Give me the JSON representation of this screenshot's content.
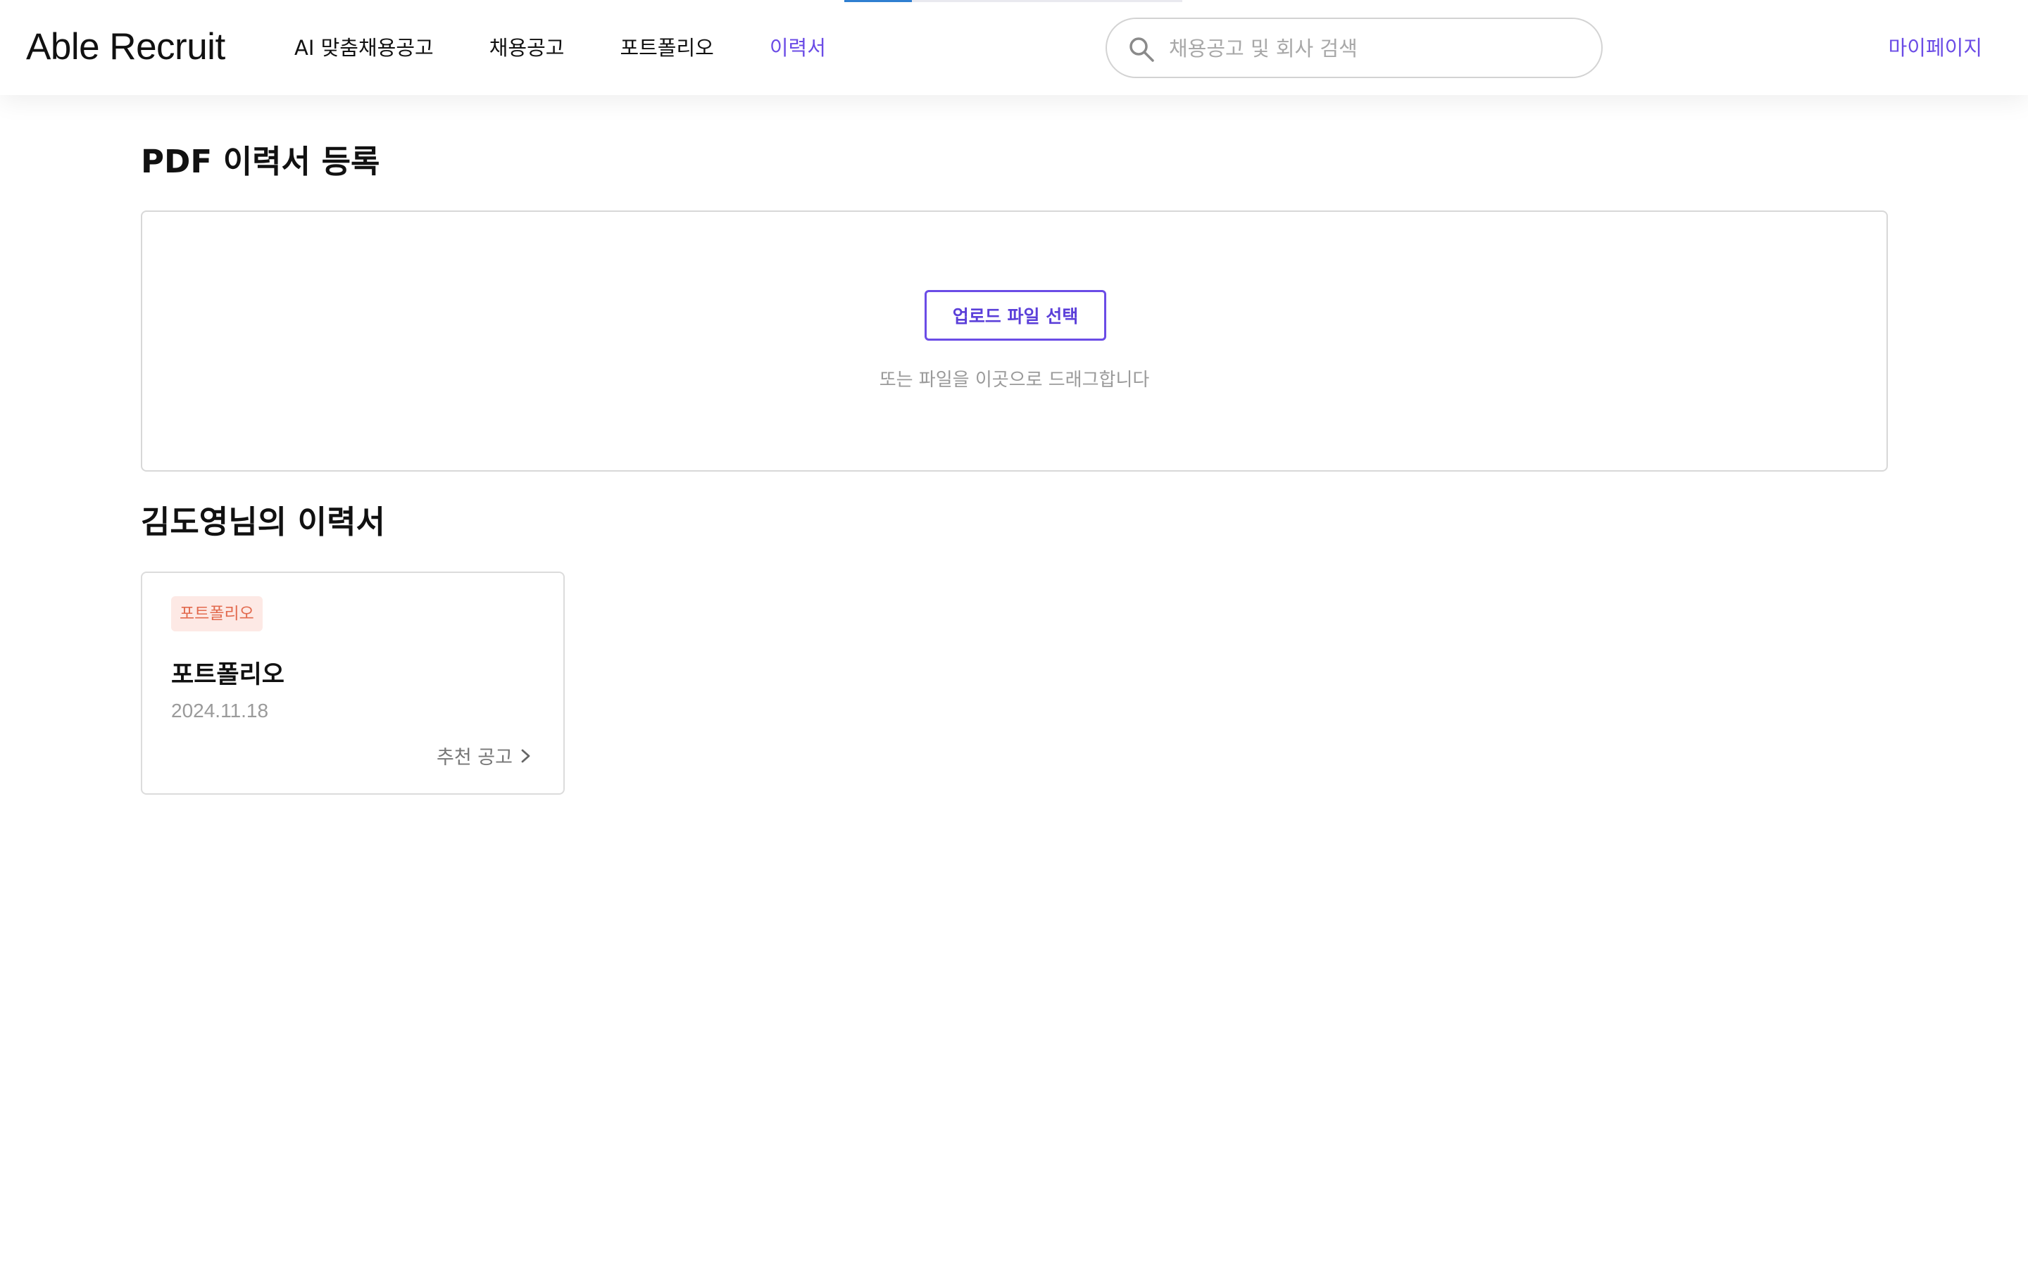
{
  "header": {
    "logo": "Able Recruit",
    "nav": [
      {
        "label": "AI 맞춤채용공고",
        "active": false
      },
      {
        "label": "채용공고",
        "active": false
      },
      {
        "label": "포트폴리오",
        "active": false
      },
      {
        "label": "이력서",
        "active": true
      }
    ],
    "search": {
      "placeholder": "채용공고 및 회사 검색",
      "value": "",
      "icon": "search-icon"
    },
    "mypage_label": "마이페이지"
  },
  "upload": {
    "title": "PDF 이력서 등록",
    "button_label": "업로드 파일 선택",
    "hint": "또는 파일을 이곳으로 드래그합니다"
  },
  "resumes": {
    "title": "김도영님의 이력서",
    "items": [
      {
        "tag": "포트폴리오",
        "title": "포트폴리오",
        "date": "2024.11.18",
        "link_label": "추천 공고",
        "link_icon": "chevron-right-icon"
      }
    ]
  },
  "colors": {
    "accent": "#6b4ce6",
    "tag_text": "#e26a4e",
    "tag_bg": "#fde9e5",
    "loading_bar": "#2f7fd1"
  }
}
